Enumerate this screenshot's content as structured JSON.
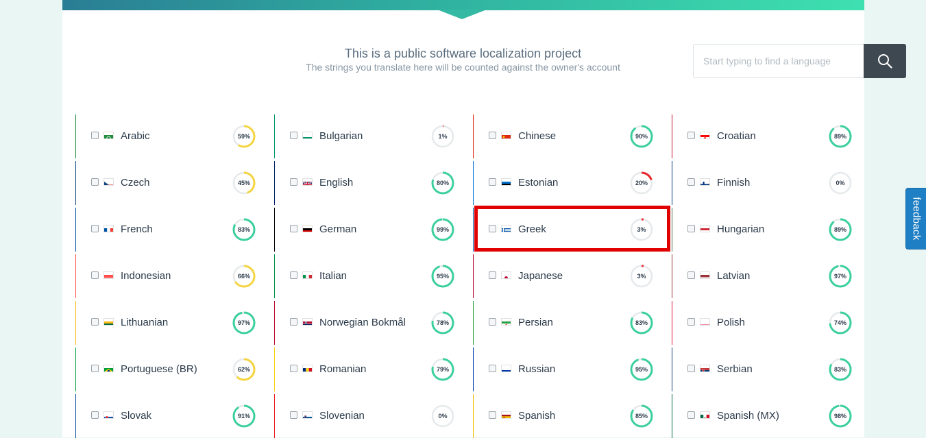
{
  "header": {
    "title": "This is a public software localization project",
    "subtitle": "The strings you translate here will be counted against the owner's account"
  },
  "search": {
    "placeholder": "Start typing to find a language",
    "value": "",
    "icon": "search-icon"
  },
  "feedback": {
    "label": "feedback"
  },
  "colors": {
    "progress_green": "#3ccf9e",
    "progress_yellow": "#f5d442",
    "progress_red": "#e8262b",
    "track": "#e6e9eb",
    "search_button": "#3d4850",
    "feedback_tab": "#1f7fc4",
    "highlight": "#e00000"
  },
  "highlighted_language": "Greek",
  "languages": [
    {
      "name": "Arabic",
      "percent": 59,
      "flag": "ar",
      "checked": false
    },
    {
      "name": "Bulgarian",
      "percent": 1,
      "flag": "bg",
      "checked": false
    },
    {
      "name": "Chinese",
      "percent": 90,
      "flag": "cn",
      "checked": false
    },
    {
      "name": "Croatian",
      "percent": 89,
      "flag": "hr",
      "checked": false
    },
    {
      "name": "Czech",
      "percent": 45,
      "flag": "cz",
      "checked": false
    },
    {
      "name": "English",
      "percent": 80,
      "flag": "gb",
      "checked": false
    },
    {
      "name": "Estonian",
      "percent": 20,
      "flag": "ee",
      "checked": false
    },
    {
      "name": "Finnish",
      "percent": 0,
      "flag": "fi",
      "checked": false
    },
    {
      "name": "French",
      "percent": 83,
      "flag": "fr",
      "checked": false
    },
    {
      "name": "German",
      "percent": 99,
      "flag": "de",
      "checked": false
    },
    {
      "name": "Greek",
      "percent": 3,
      "flag": "gr",
      "checked": false
    },
    {
      "name": "Hungarian",
      "percent": 89,
      "flag": "hu",
      "checked": false
    },
    {
      "name": "Indonesian",
      "percent": 66,
      "flag": "id",
      "checked": false
    },
    {
      "name": "Italian",
      "percent": 95,
      "flag": "it",
      "checked": false
    },
    {
      "name": "Japanese",
      "percent": 3,
      "flag": "jp",
      "checked": false
    },
    {
      "name": "Latvian",
      "percent": 97,
      "flag": "lv",
      "checked": false
    },
    {
      "name": "Lithuanian",
      "percent": 97,
      "flag": "lt",
      "checked": false
    },
    {
      "name": "Norwegian Bokmål",
      "percent": 78,
      "flag": "no",
      "checked": false
    },
    {
      "name": "Persian",
      "percent": 83,
      "flag": "ir",
      "checked": false
    },
    {
      "name": "Polish",
      "percent": 74,
      "flag": "pl",
      "checked": false
    },
    {
      "name": "Portuguese (BR)",
      "percent": 62,
      "flag": "br",
      "checked": false
    },
    {
      "name": "Romanian",
      "percent": 79,
      "flag": "ro",
      "checked": false
    },
    {
      "name": "Russian",
      "percent": 95,
      "flag": "ru",
      "checked": false
    },
    {
      "name": "Serbian",
      "percent": 83,
      "flag": "rs",
      "checked": false
    },
    {
      "name": "Slovak",
      "percent": 91,
      "flag": "sk",
      "checked": false
    },
    {
      "name": "Slovenian",
      "percent": 0,
      "flag": "si",
      "checked": false
    },
    {
      "name": "Spanish",
      "percent": 85,
      "flag": "es",
      "checked": false
    },
    {
      "name": "Spanish (MX)",
      "percent": 98,
      "flag": "mx",
      "checked": false
    }
  ]
}
